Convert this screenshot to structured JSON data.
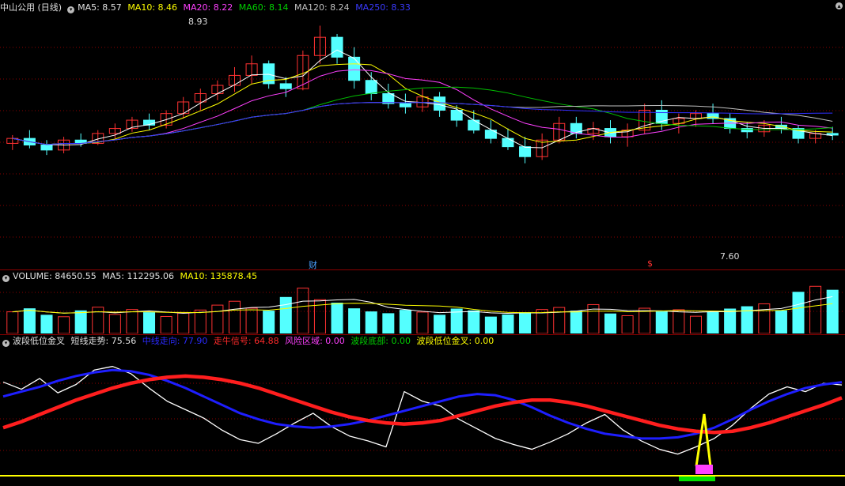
{
  "main": {
    "title": "中山公用 (日线)",
    "ma5": "MA5: 8.57",
    "ma10": "MA10: 8.46",
    "ma20": "MA20: 8.22",
    "ma60": "MA60: 8.14",
    "ma120": "MA120: 8.24",
    "ma250": "MA250: 8.33",
    "high_label": "8.93",
    "low_label": "7.60",
    "marker_cai": "财",
    "marker_dollar": "$"
  },
  "volume": {
    "title": "VOLUME: 84650.55",
    "ma5": "MA5: 112295.06",
    "ma10": "MA10: 135878.45"
  },
  "indicator": {
    "title": "波段低位金叉",
    "short_trend": "短线走势: 75.56",
    "mid_trend": "中线走向: 77.90",
    "bull_signal": "走牛信号: 64.88",
    "risk_zone": "风险区域: 0.00",
    "band_bottom": "波段底部: 0.00",
    "golden_cross": "波段低位金叉: 0.00"
  },
  "colors": {
    "up": "#ff3232",
    "down": "#54ffff",
    "ma5": "#ffffff",
    "ma10": "#ffff00",
    "ma20": "#ff40ff",
    "ma60": "#00c000",
    "ma120": "#c0c0c0",
    "ma250": "#3030ff",
    "grid": "#8a0000",
    "short_line": "#ffffff",
    "mid_line": "#1e1eff",
    "bull_line": "#ff1e1e"
  },
  "chart_data": [
    {
      "type": "candlestick",
      "title": "中山公用 (日线)",
      "high_marker": 8.93,
      "low_marker": 7.6,
      "ohlc": [
        [
          8.22,
          8.27,
          8.18,
          8.25
        ],
        [
          8.25,
          8.3,
          8.19,
          8.21
        ],
        [
          8.21,
          8.24,
          8.15,
          8.18
        ],
        [
          8.18,
          8.26,
          8.16,
          8.24
        ],
        [
          8.24,
          8.28,
          8.2,
          8.22
        ],
        [
          8.22,
          8.3,
          8.21,
          8.28
        ],
        [
          8.28,
          8.34,
          8.25,
          8.31
        ],
        [
          8.31,
          8.38,
          8.29,
          8.36
        ],
        [
          8.36,
          8.4,
          8.3,
          8.33
        ],
        [
          8.33,
          8.42,
          8.31,
          8.4
        ],
        [
          8.4,
          8.5,
          8.37,
          8.47
        ],
        [
          8.47,
          8.55,
          8.42,
          8.52
        ],
        [
          8.52,
          8.6,
          8.48,
          8.57
        ],
        [
          8.57,
          8.68,
          8.53,
          8.63
        ],
        [
          8.63,
          8.75,
          8.58,
          8.7
        ],
        [
          8.7,
          8.72,
          8.55,
          8.58
        ],
        [
          8.58,
          8.62,
          8.5,
          8.55
        ],
        [
          8.55,
          8.78,
          8.54,
          8.75
        ],
        [
          8.75,
          8.93,
          8.7,
          8.86
        ],
        [
          8.86,
          8.88,
          8.7,
          8.74
        ],
        [
          8.74,
          8.8,
          8.55,
          8.6
        ],
        [
          8.6,
          8.65,
          8.48,
          8.52
        ],
        [
          8.52,
          8.58,
          8.43,
          8.46
        ],
        [
          8.46,
          8.52,
          8.4,
          8.44
        ],
        [
          8.44,
          8.55,
          8.41,
          8.5
        ],
        [
          8.5,
          8.53,
          8.38,
          8.42
        ],
        [
          8.42,
          8.45,
          8.32,
          8.36
        ],
        [
          8.36,
          8.42,
          8.28,
          8.3
        ],
        [
          8.3,
          8.36,
          8.22,
          8.25
        ],
        [
          8.25,
          8.31,
          8.18,
          8.2
        ],
        [
          8.2,
          8.26,
          8.1,
          8.14
        ],
        [
          8.14,
          8.28,
          8.12,
          8.24
        ],
        [
          8.24,
          8.38,
          8.22,
          8.34
        ],
        [
          8.34,
          8.38,
          8.25,
          8.28
        ],
        [
          8.28,
          8.35,
          8.24,
          8.31
        ],
        [
          8.31,
          8.36,
          8.22,
          8.26
        ],
        [
          8.26,
          8.34,
          8.2,
          8.3
        ],
        [
          8.3,
          8.46,
          8.28,
          8.42
        ],
        [
          8.42,
          8.48,
          8.3,
          8.34
        ],
        [
          8.34,
          8.4,
          8.28,
          8.37
        ],
        [
          8.37,
          8.42,
          8.32,
          8.4
        ],
        [
          8.4,
          8.46,
          8.34,
          8.37
        ],
        [
          8.37,
          8.4,
          8.28,
          8.31
        ],
        [
          8.31,
          8.35,
          8.25,
          8.29
        ],
        [
          8.29,
          8.36,
          8.26,
          8.33
        ],
        [
          8.33,
          8.38,
          8.28,
          8.31
        ],
        [
          8.31,
          8.33,
          8.22,
          8.25
        ],
        [
          8.25,
          8.3,
          8.22,
          8.28
        ],
        [
          8.28,
          8.32,
          8.24,
          8.27
        ]
      ]
    },
    {
      "type": "bar",
      "title": "VOLUME",
      "values": [
        84,
        96,
        71,
        65,
        88,
        102,
        74,
        93,
        81,
        66,
        79,
        91,
        110,
        125,
        98,
        87,
        140,
        176,
        131,
        118,
        96,
        84,
        77,
        90,
        83,
        71,
        95,
        88,
        64,
        72,
        81,
        93,
        101,
        87,
        112,
        76,
        69,
        98,
        84,
        92,
        67,
        83,
        95,
        104,
        115,
        88,
        160,
        183,
        168
      ]
    },
    {
      "type": "line",
      "title": "波段低位金叉",
      "series": [
        {
          "name": "短线走势",
          "values": [
            78,
            72,
            81,
            69,
            76,
            88,
            91,
            85,
            73,
            62,
            55,
            48,
            38,
            30,
            27,
            35,
            44,
            52,
            41,
            33,
            29,
            24,
            70,
            62,
            58,
            47,
            39,
            31,
            26,
            22,
            28,
            35,
            44,
            51,
            38,
            29,
            22,
            18,
            24,
            31,
            42,
            56,
            68,
            74,
            70,
            77,
            75.56
          ]
        },
        {
          "name": "中线走向",
          "values": [
            66,
            70,
            74,
            79,
            83,
            86,
            88,
            87,
            84,
            79,
            73,
            66,
            59,
            52,
            47,
            43,
            41,
            40,
            41,
            43,
            46,
            50,
            54,
            58,
            62,
            66,
            68,
            67,
            63,
            57,
            50,
            44,
            39,
            35,
            33,
            31,
            31,
            32,
            35,
            40,
            47,
            55,
            62,
            68,
            73,
            76,
            77.9
          ]
        },
        {
          "name": "走牛信号",
          "values": [
            40,
            45,
            51,
            57,
            63,
            68,
            73,
            77,
            80,
            82,
            83,
            82,
            80,
            77,
            73,
            68,
            63,
            58,
            53,
            49,
            46,
            44,
            43,
            44,
            46,
            50,
            54,
            58,
            61,
            63,
            63,
            61,
            58,
            54,
            50,
            46,
            42,
            39,
            37,
            36,
            37,
            40,
            44,
            49,
            54,
            59,
            64.88
          ]
        }
      ]
    }
  ]
}
